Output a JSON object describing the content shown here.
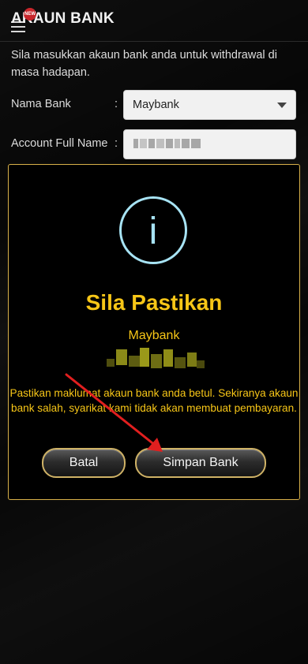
{
  "header": {
    "title": "AKAUN BANK",
    "new_badge": "NEW"
  },
  "intro": "Sila masukkan akaun bank anda untuk withdrawal di masa hadapan.",
  "form": {
    "bank_label": "Nama Bank",
    "bank_value": "Maybank",
    "name_label": "Account Full Name",
    "colon": ":"
  },
  "modal": {
    "icon": "info-icon",
    "title": "Sila Pastikan",
    "bank": "Maybank",
    "message": "Pastikan maklumat akaun bank anda betul. Sekiranya akaun bank salah, syarikat kami tidak akan membuat pembayaran.",
    "cancel_label": "Batal",
    "confirm_label": "Simpan Bank"
  },
  "colors": {
    "accent_gold": "#f7c617",
    "border_gold": "#d9b14a",
    "info_blue": "#a7e3f4",
    "annotation_red": "#e11f1f"
  }
}
